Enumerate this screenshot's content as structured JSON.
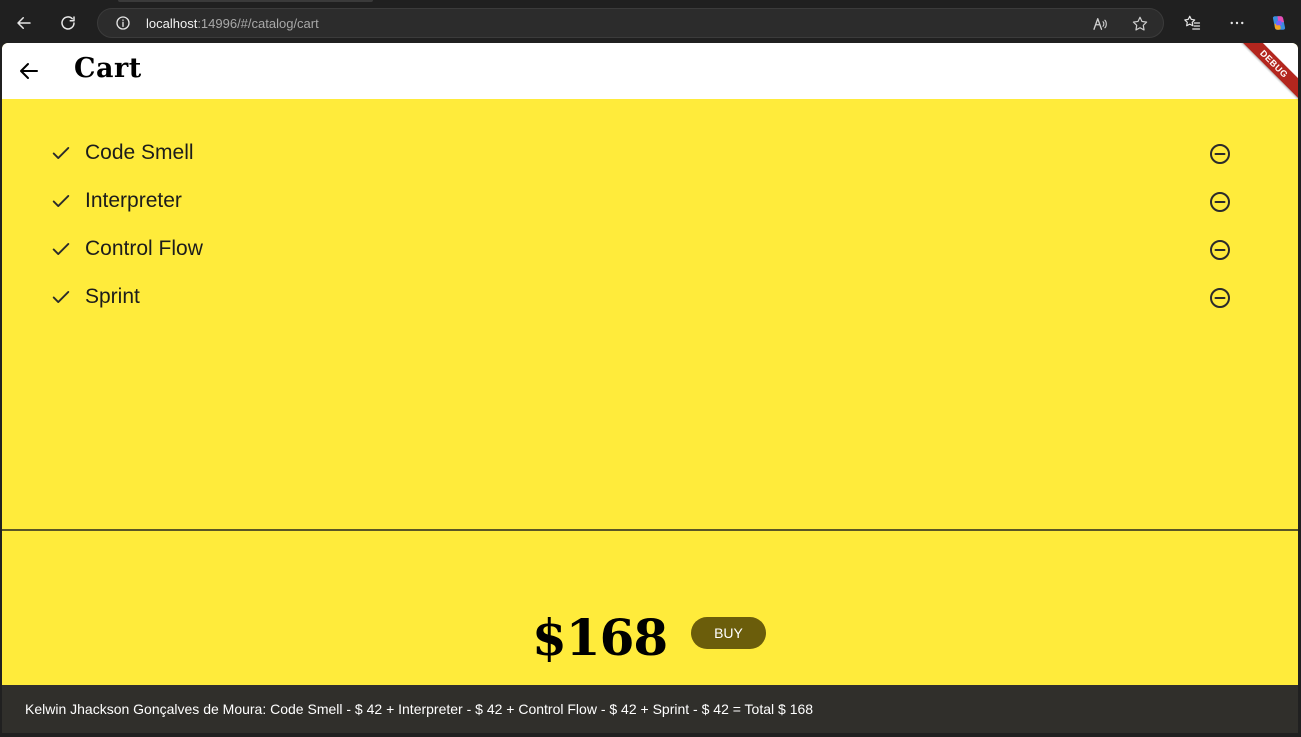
{
  "browser": {
    "url_host": "localhost",
    "url_rest": ":14996/#/catalog/cart"
  },
  "appbar": {
    "title": "Cart",
    "debug_label": "DEBUG"
  },
  "cart": {
    "items": [
      {
        "name": "Code Smell"
      },
      {
        "name": "Interpreter"
      },
      {
        "name": "Control Flow"
      },
      {
        "name": "Sprint"
      }
    ],
    "total": "$168",
    "buy_label": "BUY"
  },
  "footer": {
    "text": "Kelwin Jhackson Gonçalves de Moura: Code Smell - $ 42 + Interpreter - $ 42 + Control Flow - $ 42 + Sprint - $ 42 = Total $ 168"
  },
  "colors": {
    "background": "#ffeb3b",
    "buy_button": "#6b5d0b",
    "footer": "#302f2b"
  }
}
